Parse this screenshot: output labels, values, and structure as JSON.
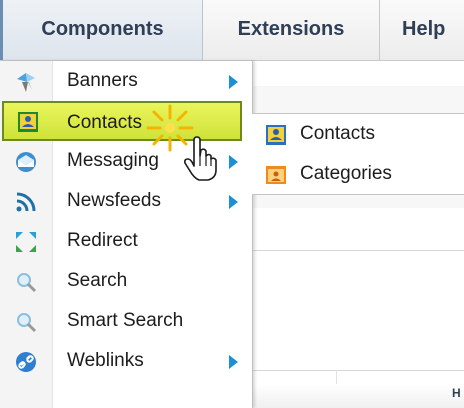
{
  "menubar": {
    "components": "Components",
    "extensions": "Extensions",
    "help": "Help"
  },
  "components_menu": {
    "items": [
      {
        "label": "Banners",
        "icon": "banners-icon",
        "has_submenu": true
      },
      {
        "label": "Contacts",
        "icon": "contacts-icon",
        "has_submenu": true,
        "active": true
      },
      {
        "label": "Messaging",
        "icon": "messaging-icon",
        "has_submenu": true
      },
      {
        "label": "Newsfeeds",
        "icon": "newsfeeds-icon",
        "has_submenu": true
      },
      {
        "label": "Redirect",
        "icon": "redirect-icon",
        "has_submenu": false
      },
      {
        "label": "Search",
        "icon": "search-icon",
        "has_submenu": false
      },
      {
        "label": "Smart Search",
        "icon": "smart-search-icon",
        "has_submenu": false
      },
      {
        "label": "Weblinks",
        "icon": "weblinks-icon",
        "has_submenu": true
      }
    ]
  },
  "contacts_submenu": {
    "items": [
      {
        "label": "Contacts",
        "icon": "contacts-icon"
      },
      {
        "label": "Categories",
        "icon": "categories-icon"
      }
    ]
  },
  "background": {
    "partial_letter": "H"
  },
  "colors": {
    "active_bg": "#dfeb4a",
    "active_border": "#6d8a1c",
    "arrow": "#1e8fd6",
    "menu_text": "#2f3f56"
  }
}
